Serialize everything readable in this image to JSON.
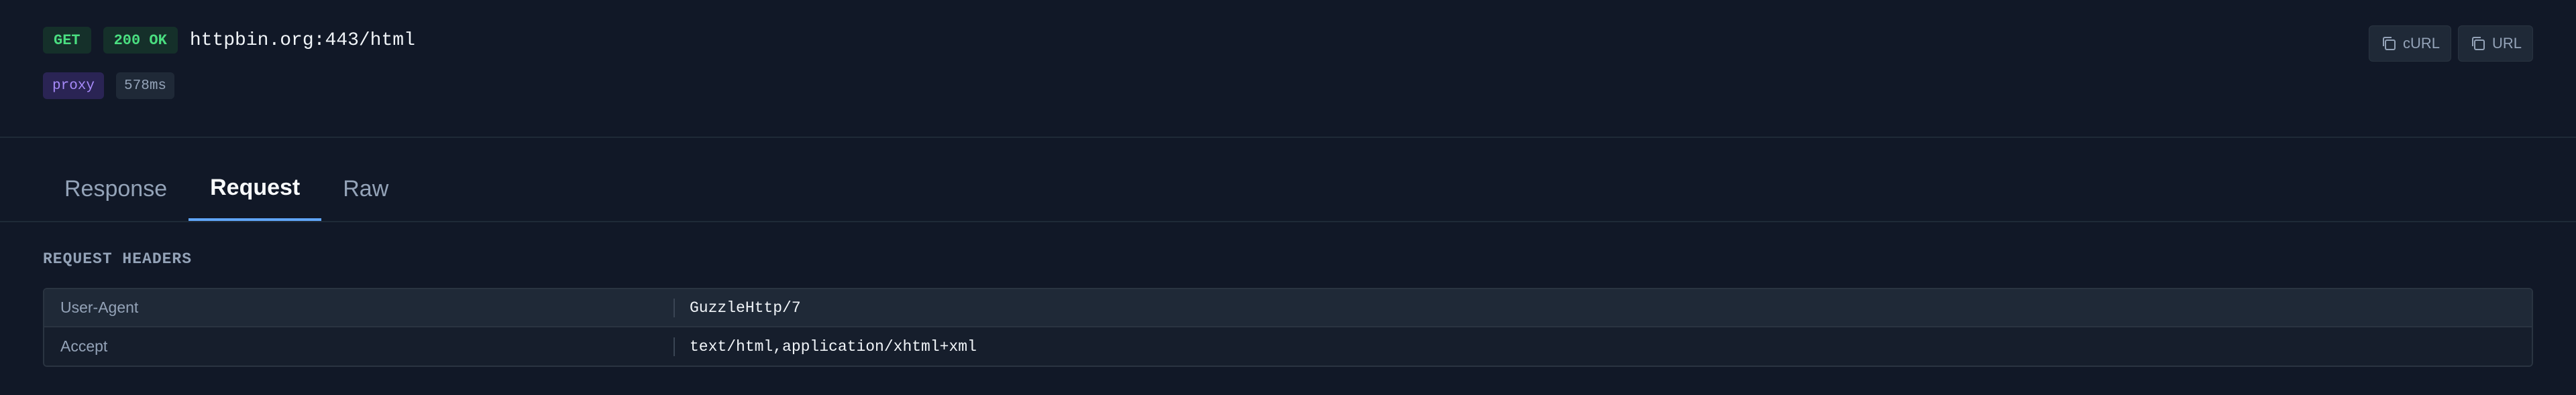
{
  "request": {
    "method": "GET",
    "status": "200 OK",
    "url": "httpbin.org:443/html",
    "tag": "proxy",
    "duration": "578ms"
  },
  "actions": {
    "copy_curl_label": "cURL",
    "copy_url_label": "URL",
    "icon": "copy-icon"
  },
  "tabs": [
    {
      "label": "Response",
      "active": false
    },
    {
      "label": "Request",
      "active": true
    },
    {
      "label": "Raw",
      "active": false
    }
  ],
  "request_headers": {
    "title": "REQUEST HEADERS",
    "rows": [
      {
        "key": "User-Agent",
        "value": "GuzzleHttp/7"
      },
      {
        "key": "Accept",
        "value": "text/html,application/xhtml+xml"
      }
    ]
  },
  "colors": {
    "background": "#111827",
    "success": "#4ade80",
    "accent": "#60a5fa",
    "tag": "#a78bfa"
  }
}
